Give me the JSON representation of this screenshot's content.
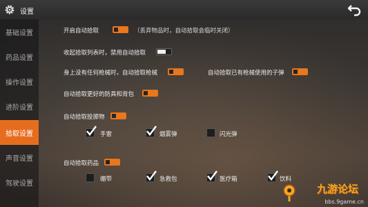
{
  "header": {
    "title": "设置"
  },
  "sidebar": {
    "items": [
      {
        "label": "基础设置"
      },
      {
        "label": "药品设置"
      },
      {
        "label": "操作设置"
      },
      {
        "label": "进阶设置"
      },
      {
        "label": "拾取设置",
        "active": true
      },
      {
        "label": "声音设置"
      },
      {
        "label": "驾驶设置"
      }
    ]
  },
  "settings": {
    "auto_pickup": {
      "label": "开启自动拾取",
      "state": "on",
      "note": "（丢弃物品时，自动拾取会临时关闭）"
    },
    "collapse_list": {
      "label": "收起拾取列表时，禁用自动拾取",
      "state": "off"
    },
    "no_gun": {
      "label": "身上没有任何枪械时，自动拾取枪械",
      "state": "on"
    },
    "gun_ammo": {
      "label": "自动拾取已有枪械使用的子弹",
      "state": "on"
    },
    "better_armor": {
      "label": "自动拾取更好的防具和背包",
      "state": "on"
    },
    "throwables": {
      "label": "自动拾取投掷物",
      "state": "on",
      "options": [
        {
          "label": "手雷",
          "checked": true
        },
        {
          "label": "烟雾弹",
          "checked": true
        },
        {
          "label": "闪光弹",
          "checked": false
        }
      ]
    },
    "medicine": {
      "label": "自动拾取药品",
      "state": "on",
      "options": [
        {
          "label": "绷带",
          "checked": false
        },
        {
          "label": "急救包",
          "checked": true
        },
        {
          "label": "医疗箱",
          "checked": true
        },
        {
          "label": "饮料",
          "checked": true
        }
      ]
    }
  },
  "watermark": {
    "brand": "九游论坛",
    "site": "bbs.9game.cn"
  },
  "colors": {
    "accent": "#e8771e",
    "header": "#2d2d2e"
  },
  "icons": {
    "settings": "gear-icon",
    "back": "back-arrow-icon",
    "check": "check-icon"
  }
}
